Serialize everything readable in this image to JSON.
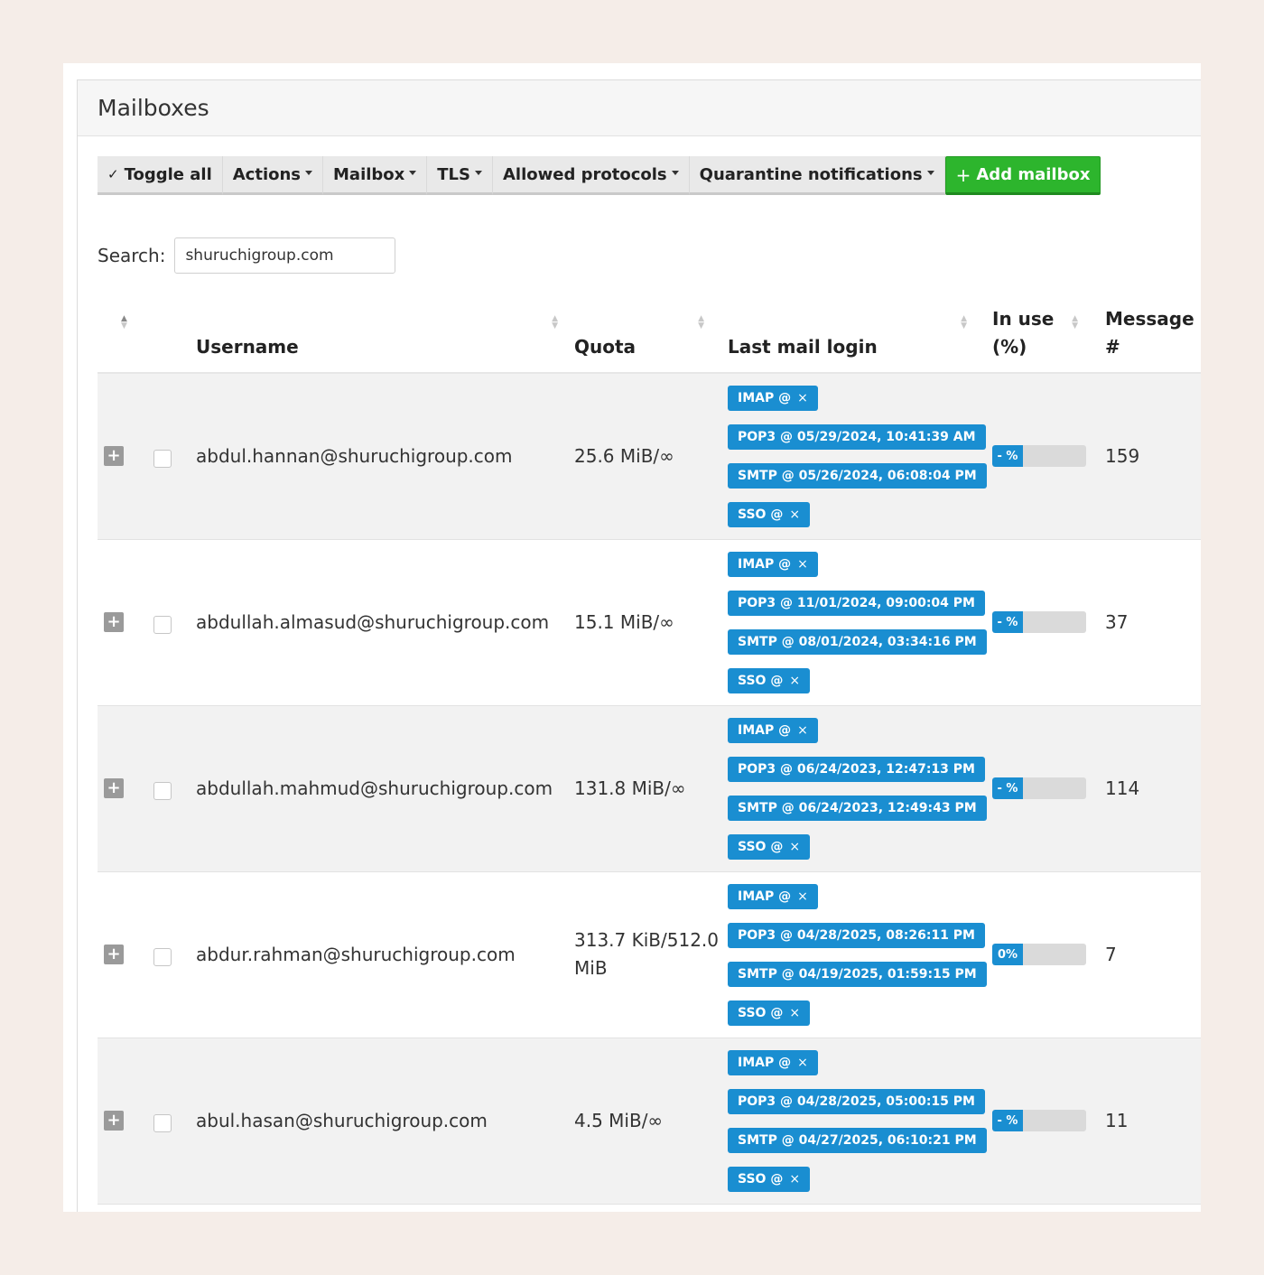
{
  "panel": {
    "title": "Mailboxes"
  },
  "toolbar": {
    "toggle_all": "Toggle all",
    "actions": "Actions",
    "mailbox": "Mailbox",
    "tls": "TLS",
    "allowed_protocols": "Allowed protocols",
    "quarantine_notifications": "Quarantine notifications",
    "add_mailbox": "Add mailbox"
  },
  "search": {
    "label": "Search:",
    "value": "shuruchigroup.com"
  },
  "table": {
    "columns": {
      "username": "Username",
      "quota": "Quota",
      "last_mail_login": "Last mail login",
      "in_use": "In use (%)",
      "messages": "Message #"
    },
    "rows": [
      {
        "username": "abdul.hannan@shuruchigroup.com",
        "quota": "25.6 MiB/∞",
        "imap": "IMAP @",
        "pop3": "POP3 @ 05/29/2024, 10:41:39 AM",
        "smtp": "SMTP @ 05/26/2024, 06:08:04 PM",
        "sso": "SSO @",
        "in_use_label": "- %",
        "in_use_fraction": 0,
        "messages": "159"
      },
      {
        "username": "abdullah.almasud@shuruchigroup.com",
        "quota": "15.1 MiB/∞",
        "imap": "IMAP @",
        "pop3": "POP3 @ 11/01/2024, 09:00:04 PM",
        "smtp": "SMTP @ 08/01/2024, 03:34:16 PM",
        "sso": "SSO @",
        "in_use_label": "- %",
        "in_use_fraction": 0,
        "messages": "37"
      },
      {
        "username": "abdullah.mahmud@shuruchigroup.com",
        "quota": "131.8 MiB/∞",
        "imap": "IMAP @",
        "pop3": "POP3 @ 06/24/2023, 12:47:13 PM",
        "smtp": "SMTP @ 06/24/2023, 12:49:43 PM",
        "sso": "SSO @",
        "in_use_label": "- %",
        "in_use_fraction": 0,
        "messages": "114"
      },
      {
        "username": "abdur.rahman@shuruchigroup.com",
        "quota": "313.7 KiB/512.0 MiB",
        "imap": "IMAP @",
        "pop3": "POP3 @ 04/28/2025, 08:26:11 PM",
        "smtp": "SMTP @ 04/19/2025, 01:59:15 PM",
        "sso": "SSO @",
        "in_use_label": "0%",
        "in_use_fraction": 0,
        "messages": "7"
      },
      {
        "username": "abul.hasan@shuruchigroup.com",
        "quota": "4.5 MiB/∞",
        "imap": "IMAP @",
        "pop3": "POP3 @ 04/28/2025, 05:00:15 PM",
        "smtp": "SMTP @ 04/27/2025, 06:10:21 PM",
        "sso": "SSO @",
        "in_use_label": "- %",
        "in_use_fraction": 0,
        "messages": "11"
      }
    ]
  },
  "colors": {
    "badge": "#1a8ed1",
    "add_button": "#2db52d",
    "page_background": "#f5ede8"
  }
}
